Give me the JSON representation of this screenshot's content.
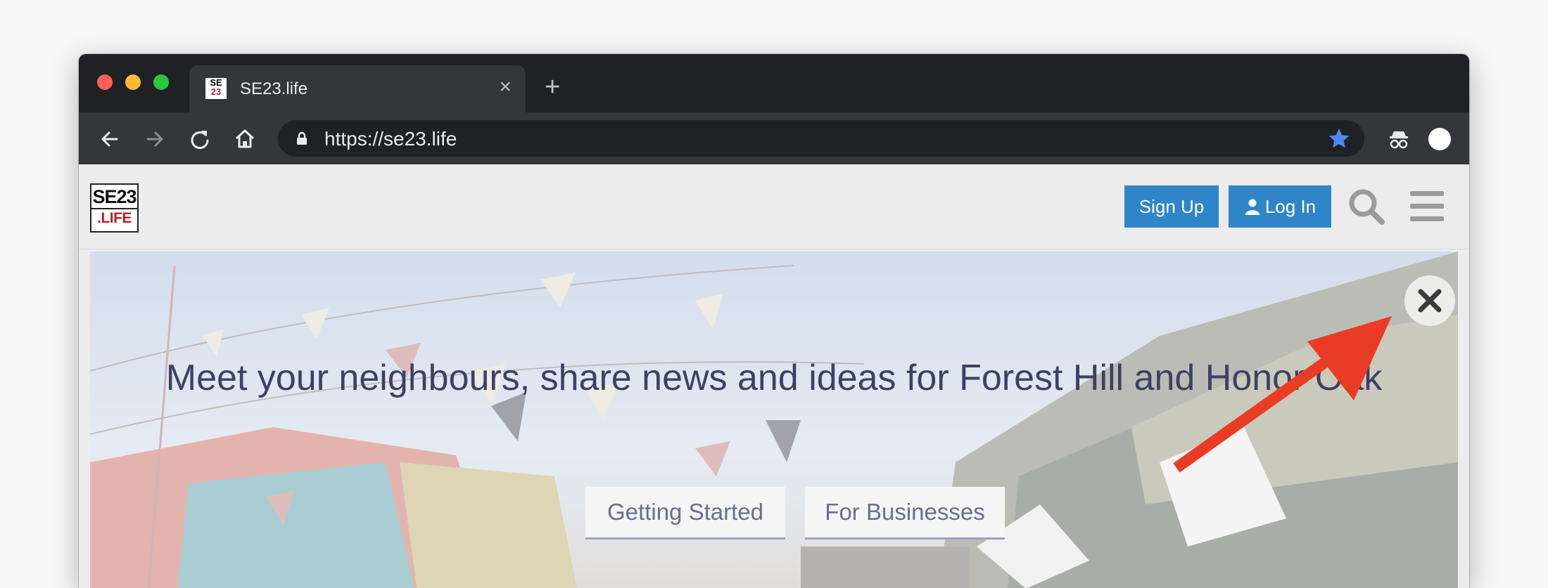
{
  "browser": {
    "tab_title": "SE23.life",
    "favicon_text_top": "SE",
    "favicon_text_bottom": "23",
    "url": "https://se23.life",
    "new_tab_symbol": "+",
    "tab_close_symbol": "×",
    "icons": [
      "back-icon",
      "forward-icon",
      "reload-icon",
      "home-icon",
      "lock-icon",
      "star-icon",
      "incognito-extension-icon",
      "profile-icon"
    ]
  },
  "site": {
    "logo_line1": "SE23",
    "logo_line2": ".LIFE",
    "signup_label": "Sign Up",
    "login_label": "Log In",
    "icons": [
      "search-icon",
      "hamburger-menu-icon"
    ]
  },
  "banner": {
    "title": "Meet your neighbours, share news and ideas for Forest Hill and Honor Oak",
    "buttons": [
      "Getting Started",
      "For Businesses"
    ],
    "close_icon": "close-icon"
  },
  "annotation": {
    "arrow_color": "#ea3c25",
    "points_to": "banner-close-button"
  },
  "colors": {
    "accent": "#2f85c8",
    "chrome_dark": "#202124",
    "chrome_toolbar": "#35363a",
    "star": "#4a8af4",
    "logo_red": "#b72020"
  }
}
